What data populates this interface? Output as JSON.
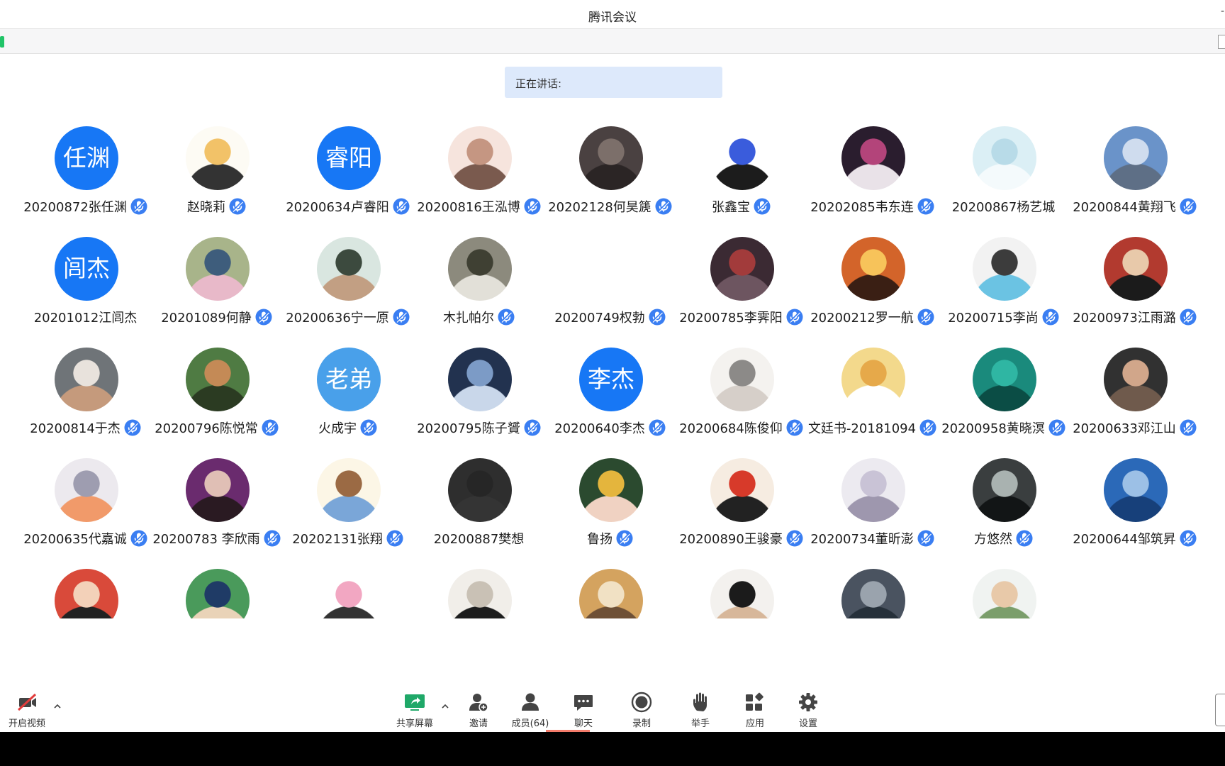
{
  "window": {
    "title": "腾讯会议"
  },
  "speaking": {
    "label": "正在讲话:"
  },
  "participants": [
    {
      "name": "20200872张任渊",
      "avatar_text": "任渊",
      "avatar_kind": "text",
      "mic": true,
      "avatar_colors": [
        "#1777f5"
      ]
    },
    {
      "name": "赵晓莉",
      "avatar_kind": "image",
      "mic": true,
      "avatar_colors": [
        "#fdfbf4",
        "#f2c268",
        "#333333"
      ]
    },
    {
      "name": "20200634卢睿阳",
      "avatar_text": "睿阳",
      "avatar_kind": "text",
      "mic": true,
      "avatar_colors": [
        "#1777f5"
      ]
    },
    {
      "name": "20200816王泓博",
      "avatar_kind": "image",
      "mic": true,
      "avatar_colors": [
        "#f6e4dd",
        "#c59682",
        "#7a5a4e"
      ]
    },
    {
      "name": "20202128何昊篪",
      "avatar_kind": "image",
      "mic": true,
      "avatar_colors": [
        "#4a4141",
        "#7c6f6a",
        "#2b2525"
      ]
    },
    {
      "name": "张鑫宝",
      "avatar_kind": "image",
      "mic": true,
      "avatar_colors": [
        "#ffffff",
        "#3a5cdc",
        "#1c1c1c"
      ]
    },
    {
      "name": "20202085韦东连",
      "avatar_kind": "image",
      "mic": true,
      "avatar_colors": [
        "#2a1d2e",
        "#b3447a",
        "#e9e2e8"
      ]
    },
    {
      "name": "20200867杨艺城",
      "avatar_kind": "image",
      "mic": false,
      "avatar_colors": [
        "#dbeff5",
        "#b8dbe8",
        "#f4fafc"
      ]
    },
    {
      "name": "20200844黄翔飞",
      "avatar_kind": "image",
      "mic": true,
      "avatar_colors": [
        "#6a93c9",
        "#cfdcee",
        "#5e6f86"
      ]
    },
    {
      "name": "20201012江闾杰",
      "avatar_text": "闾杰",
      "avatar_kind": "text",
      "mic": false,
      "avatar_colors": [
        "#1777f5"
      ]
    },
    {
      "name": "20201089何静",
      "avatar_kind": "image",
      "mic": true,
      "avatar_colors": [
        "#a8b48a",
        "#3e5d7c",
        "#e8b9c9"
      ]
    },
    {
      "name": "20200636宁一原",
      "avatar_kind": "image",
      "mic": true,
      "avatar_colors": [
        "#d9e6e0",
        "#3c4a3e",
        "#c29f83"
      ]
    },
    {
      "name": "木扎帕尔",
      "avatar_kind": "image",
      "mic": true,
      "avatar_colors": [
        "#8c8a7d",
        "#3f4033",
        "#e2e0d8"
      ]
    },
    {
      "name": "20200749权勃",
      "avatar_kind": "blank",
      "mic": true,
      "avatar_colors": [
        "#ffffff"
      ]
    },
    {
      "name": "20200785李霁阳",
      "avatar_kind": "image",
      "mic": true,
      "avatar_colors": [
        "#3b2a33",
        "#a23b3b",
        "#6d5560"
      ]
    },
    {
      "name": "20200212罗一航",
      "avatar_kind": "image",
      "mic": true,
      "avatar_colors": [
        "#d3642a",
        "#f7c35a",
        "#3a1f14"
      ]
    },
    {
      "name": "20200715李尚",
      "avatar_kind": "image",
      "mic": true,
      "avatar_colors": [
        "#f2f2f2",
        "#3c3c3c",
        "#6bc3e3"
      ]
    },
    {
      "name": "20200973江雨潞",
      "avatar_kind": "image",
      "mic": true,
      "avatar_colors": [
        "#b23a2f",
        "#e8c9aa",
        "#1b1b1b"
      ]
    },
    {
      "name": "20200814于杰",
      "avatar_kind": "image",
      "mic": true,
      "avatar_colors": [
        "#6f7478",
        "#e8e2dc",
        "#c59a7c"
      ]
    },
    {
      "name": "20200796陈悦常",
      "avatar_kind": "image",
      "mic": true,
      "avatar_colors": [
        "#4f7b43",
        "#c48a56",
        "#2b3b22"
      ]
    },
    {
      "name": "火成宇",
      "avatar_text": "老弟",
      "avatar_kind": "text-light",
      "mic": true,
      "avatar_colors": [
        "#49a0ea"
      ]
    },
    {
      "name": "20200795陈子贇",
      "avatar_kind": "image",
      "mic": true,
      "avatar_colors": [
        "#22324f",
        "#7c9bc6",
        "#c9d7ea"
      ]
    },
    {
      "name": "20200640李杰",
      "avatar_text": "李杰",
      "avatar_kind": "text",
      "mic": true,
      "avatar_colors": [
        "#1777f5"
      ]
    },
    {
      "name": "20200684陈俊仰",
      "avatar_kind": "image",
      "mic": true,
      "avatar_colors": [
        "#f4f2ef",
        "#8c8a88",
        "#d6cfc9"
      ]
    },
    {
      "name": "文廷书-20181094",
      "avatar_kind": "image",
      "mic": true,
      "avatar_colors": [
        "#f3d98c",
        "#e6a94a",
        "#ffffff"
      ]
    },
    {
      "name": "20200958黄晓溟",
      "avatar_kind": "image",
      "mic": true,
      "avatar_colors": [
        "#1a8a7c",
        "#2fb6a3",
        "#0b4d45"
      ]
    },
    {
      "name": "20200633邓江山",
      "avatar_kind": "image",
      "mic": true,
      "avatar_colors": [
        "#313131",
        "#d1a68a",
        "#6f5a4c"
      ]
    },
    {
      "name": "20200635代嘉诚",
      "avatar_kind": "image",
      "mic": true,
      "avatar_colors": [
        "#ece9ee",
        "#9e9db0",
        "#f19a6a"
      ]
    },
    {
      "name": "20200783 李欣雨",
      "avatar_kind": "image",
      "mic": true,
      "avatar_colors": [
        "#6a2b6e",
        "#e0bfb5",
        "#2a1a22"
      ]
    },
    {
      "name": "20202131张翔",
      "avatar_kind": "image",
      "mic": true,
      "avatar_colors": [
        "#fcf6e6",
        "#9b6a44",
        "#7aa6d8"
      ]
    },
    {
      "name": "20200887樊想",
      "avatar_kind": "image",
      "mic": false,
      "avatar_colors": [
        "#2e2e2e",
        "#262626",
        "#343434"
      ]
    },
    {
      "name": "鲁扬",
      "avatar_kind": "image",
      "mic": true,
      "avatar_colors": [
        "#2b4a2f",
        "#e4b53d",
        "#f0d2c2"
      ]
    },
    {
      "name": "20200890王骏豪",
      "avatar_kind": "image",
      "mic": true,
      "avatar_colors": [
        "#f6ece1",
        "#d73a2a",
        "#222222"
      ]
    },
    {
      "name": "20200734董昕澎",
      "avatar_kind": "image",
      "mic": true,
      "avatar_colors": [
        "#eceaf0",
        "#c9c3d6",
        "#9e97ae"
      ]
    },
    {
      "name": "方悠然",
      "avatar_kind": "image",
      "mic": true,
      "avatar_colors": [
        "#3a3e3f",
        "#a9b2b0",
        "#121516"
      ]
    },
    {
      "name": "20200644邹筑昇",
      "avatar_kind": "image",
      "mic": true,
      "avatar_colors": [
        "#2b69b8",
        "#9cc0e6",
        "#17407a"
      ]
    },
    {
      "name": "",
      "avatar_kind": "image",
      "mic": false,
      "avatar_colors": [
        "#d94a3a",
        "#f3d1b9",
        "#222222"
      ]
    },
    {
      "name": "",
      "avatar_kind": "image",
      "mic": false,
      "avatar_colors": [
        "#4a9a5b",
        "#1f3b66",
        "#e9d3b8"
      ]
    },
    {
      "name": "",
      "avatar_kind": "image",
      "mic": false,
      "avatar_colors": [
        "#ffffff",
        "#f2a7c2",
        "#333333"
      ]
    },
    {
      "name": "",
      "avatar_kind": "image",
      "mic": false,
      "avatar_colors": [
        "#f1eee9",
        "#c9c1b5",
        "#1d1d1d"
      ]
    },
    {
      "name": "",
      "avatar_kind": "image",
      "mic": false,
      "avatar_colors": [
        "#d4a35f",
        "#f1e1c4",
        "#6e5036"
      ]
    },
    {
      "name": "",
      "avatar_kind": "image",
      "mic": false,
      "avatar_colors": [
        "#f3f1ee",
        "#1b1b1b",
        "#d7b79a"
      ]
    },
    {
      "name": "",
      "avatar_kind": "image",
      "mic": false,
      "avatar_colors": [
        "#4a5360",
        "#9aa3ad",
        "#26303a"
      ]
    },
    {
      "name": "",
      "avatar_kind": "image",
      "mic": false,
      "avatar_colors": [
        "#f0f3f1",
        "#e8c9a9",
        "#7b9e6b"
      ]
    }
  ],
  "toolbar": {
    "video": {
      "label": "开启视频",
      "icon": "camera-off-icon"
    },
    "share": {
      "label": "共享屏幕",
      "icon": "share-screen-icon"
    },
    "invite": {
      "label": "邀请",
      "icon": "invite-user-icon"
    },
    "members": {
      "label": "成员(64)",
      "icon": "members-icon"
    },
    "chat": {
      "label": "聊天",
      "icon": "chat-icon"
    },
    "record": {
      "label": "录制",
      "icon": "record-icon"
    },
    "raise_hand": {
      "label": "举手",
      "icon": "raise-hand-icon"
    },
    "apps": {
      "label": "应用",
      "icon": "apps-icon"
    },
    "settings": {
      "label": "设置",
      "icon": "gear-icon"
    }
  },
  "colors": {
    "accent": "#1777f5",
    "mic": "#3a7ef2",
    "speaking_bg": "#dde9fb",
    "signal": "#21c468",
    "share_green": "#1fa868",
    "members_underline": "#f37b6a"
  }
}
